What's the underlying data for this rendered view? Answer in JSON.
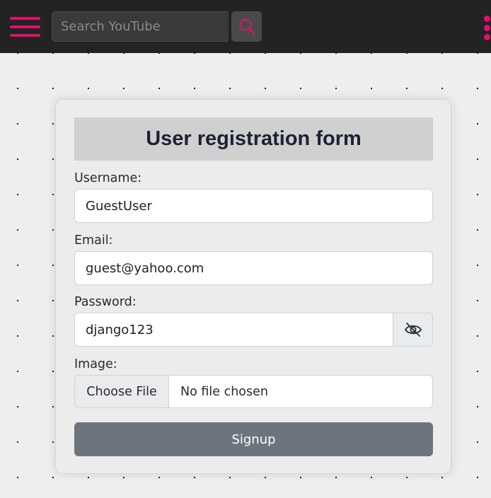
{
  "header": {
    "menu_icon": "hamburger-menu-icon",
    "search_placeholder": "Search YouTube",
    "search_icon": "search-icon",
    "more_icon": "kebab-menu-icon",
    "accent_color": "#e0106a",
    "bar_color": "#232323"
  },
  "form": {
    "title": "User registration form",
    "username_label": "Username:",
    "username_value": "GuestUser",
    "email_label": "Email:",
    "email_value": "guest@yahoo.com",
    "password_label": "Password:",
    "password_value": "django123",
    "password_toggle_icon": "eye-slash-icon",
    "image_label": "Image:",
    "choose_file_label": "Choose File",
    "file_status": "No file chosen",
    "submit_label": "Signup",
    "submit_color": "#6c757d"
  }
}
